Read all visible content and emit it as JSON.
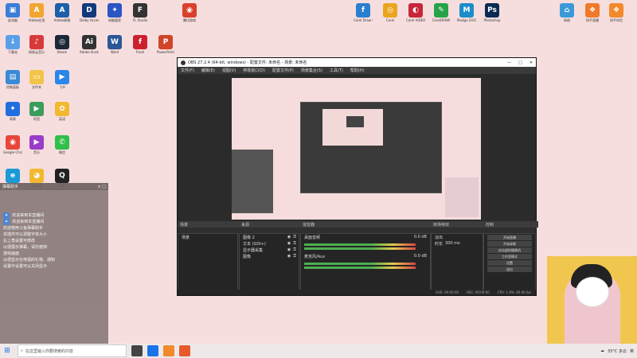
{
  "desktop_icons": [
    {
      "label": "此电脑",
      "color": "#3b7dd8",
      "glyph": "▣"
    },
    {
      "label": "Adobe应用",
      "color": "#f2a531",
      "glyph": "A"
    },
    {
      "label": "Adobe卸载",
      "color": "#1d5fa8",
      "glyph": "A"
    },
    {
      "label": "Dolby Access",
      "color": "#123a7a",
      "glyph": "D"
    },
    {
      "label": "电脑管家",
      "color": "#2a55c4",
      "glyph": "✦"
    },
    {
      "label": "FL Studio",
      "color": "#333",
      "glyph": "F"
    },
    {
      "label": "腾讯游戏",
      "color": "#d9412c",
      "glyph": "◉"
    },
    {
      "label": "Corel Draw Graphics",
      "color": "#2a7fd0",
      "glyph": "f"
    },
    {
      "label": "Corel",
      "color": "#e9a520",
      "glyph": "◎"
    },
    {
      "label": "Corel VIDEOSTUDIO",
      "color": "#c7263a",
      "glyph": "◐"
    },
    {
      "label": "CorelDRAW",
      "color": "#27a34a",
      "glyph": "✎"
    },
    {
      "label": "Mudge 2019",
      "color": "#1c8ccc",
      "glyph": "M"
    },
    {
      "label": "Photoshop",
      "color": "#0a2a53",
      "glyph": "Ps"
    },
    {
      "label": "网络",
      "color": "#3a9ad9",
      "glyph": "⌂"
    },
    {
      "label": "快手直播",
      "color": "#f07a2c",
      "glyph": "❖"
    },
    {
      "label": "快手伴侣",
      "color": "#f28a2c",
      "glyph": "❖"
    },
    {
      "label": "下载站",
      "color": "#5aa0e8",
      "glyph": "↓"
    },
    {
      "label": "网易云音乐",
      "color": "#d83a3a",
      "glyph": "♪"
    },
    {
      "label": "Steam",
      "color": "#1b2838",
      "glyph": "◎"
    },
    {
      "label": "Adobe Illustrator",
      "color": "#333",
      "glyph": "Ai"
    },
    {
      "label": "Word",
      "color": "#2b5796",
      "glyph": "W"
    },
    {
      "label": "Flash",
      "color": "#cc2030",
      "glyph": "f"
    },
    {
      "label": "PowerPoint",
      "color": "#d0442a",
      "glyph": "P"
    },
    {
      "label": "控制面板",
      "color": "#3a8ad8",
      "glyph": "▤"
    },
    {
      "label": "文件夹",
      "color": "#f2c54a",
      "glyph": "▭"
    },
    {
      "label": "飞书",
      "color": "#2a86e8",
      "glyph": "▶"
    },
    {
      "label": "网易",
      "color": "#1f6fe0",
      "glyph": "✦"
    },
    {
      "label": "阿里",
      "color": "#3c9c5c",
      "glyph": "▶"
    },
    {
      "label": "英语",
      "color": "#f2b830",
      "glyph": "✿"
    },
    {
      "label": "Google Chrome",
      "color": "#e8463a",
      "glyph": "◉"
    },
    {
      "label": "音乐",
      "color": "#9a3cc8",
      "glyph": "▶"
    },
    {
      "label": "微信",
      "color": "#2fbf4a",
      "glyph": "✆"
    },
    {
      "label": "Microsoft Edge",
      "color": "#1a9ad6",
      "glyph": "e"
    },
    {
      "label": "QQ游戏",
      "color": "#f2b830",
      "glyph": "◕"
    },
    {
      "label": "QQ",
      "color": "#222",
      "glyph": "Q"
    }
  ],
  "chat": {
    "title": "弹幕助手",
    "close": "× □",
    "messages": [
      {
        "tag": "",
        "text": "欢迎来到本直播间"
      },
      {
        "tag": "",
        "text": "欢迎来到本直播间"
      },
      {
        "tag": "",
        "text": "欢迎使用斗鱼弹幕助手"
      },
      {
        "tag": "",
        "text": "本插件可以调整字体大小"
      },
      {
        "tag": "",
        "text": "右上角设置可修改"
      },
      {
        "tag": "",
        "text": "以便展示弹幕，请勿遮挡"
      },
      {
        "tag": "",
        "text": "游戏画面"
      },
      {
        "tag": "",
        "text": "以便显示在电视的礼物、通知"
      },
      {
        "tag": "",
        "text": "设置中设置可以关闭显示"
      }
    ]
  },
  "obs": {
    "title": "OBS 27.2.4 (64-bit, windows) - 配置文件: 未命名 - 场景: 未命名",
    "controls": [
      "—",
      "□",
      "✕"
    ],
    "menu": [
      "文件(F)",
      "编辑(E)",
      "视图(V)",
      "停靠窗口(D)",
      "配置文件(P)",
      "场景集合(S)",
      "工具(T)",
      "帮助(H)"
    ],
    "dock_headers": [
      "场景",
      "来源",
      "混音器",
      "转场特效",
      "控制"
    ],
    "scene_items": [
      "场景"
    ],
    "sources": [
      {
        "name": "图像 2"
      },
      {
        "name": "文本 (GDI+)"
      },
      {
        "name": "显示器采集"
      },
      {
        "name": "图像"
      }
    ],
    "mixer": [
      {
        "name": "桌面音频",
        "value": "0.0 dB"
      },
      {
        "name": "麦克风/Aux",
        "value": "0.0 dB"
      }
    ],
    "transition": {
      "type": "淡出",
      "duration_label": "时长",
      "duration": "300 ms"
    },
    "controls_buttons": [
      "开始直播",
      "开始录制",
      "启动虚拟摄像机",
      "工作室模式",
      "设置",
      "退出"
    ],
    "status": [
      "LIVE: 00:00:00",
      "REC: 00:00:00",
      "CPU: 1.8%, 60.00 fps"
    ]
  },
  "taskbar": {
    "start_icon": "windows-logo",
    "search_placeholder": "在这里输入你要搜索的内容",
    "apps": [
      "#444",
      "#1a73e8",
      "#f28a2c",
      "#e85a2c"
    ],
    "weather": "35°C 多云",
    "lang": "英"
  }
}
